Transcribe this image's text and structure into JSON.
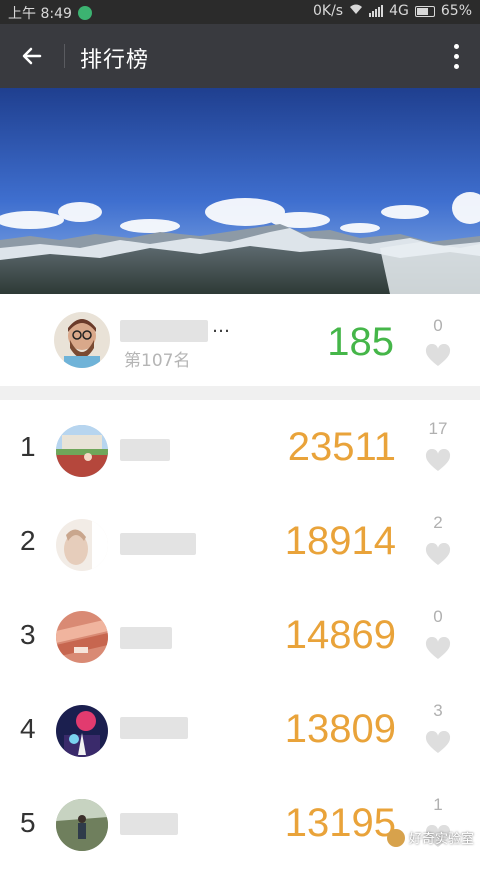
{
  "status_bar": {
    "time": "上午 8:49",
    "network_speed": "0K/s",
    "network_type": "4G",
    "battery": "65%"
  },
  "app_bar": {
    "title": "排行榜",
    "back_icon": "arrow-left-icon",
    "menu_icon": "more-vertical-icon"
  },
  "my_rank": {
    "name": "…",
    "rank_label": "第107名",
    "steps": "185",
    "likes": "0"
  },
  "ranking": [
    {
      "rank": "1",
      "steps": "23511",
      "likes": "17"
    },
    {
      "rank": "2",
      "steps": "18914",
      "likes": "2"
    },
    {
      "rank": "3",
      "steps": "14869",
      "likes": "0"
    },
    {
      "rank": "4",
      "steps": "13809",
      "likes": "3"
    },
    {
      "rank": "5",
      "steps": "13195",
      "likes": "1"
    }
  ],
  "watermark": "好奇实验室",
  "colors": {
    "header_bg": "#393a3f",
    "my_steps": "#45b649",
    "ranking_steps": "#e9a33a"
  }
}
